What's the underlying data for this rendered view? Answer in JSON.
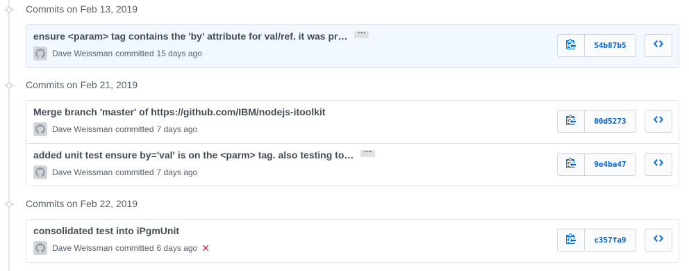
{
  "groups": [
    {
      "title": "Commits on Feb 13, 2019",
      "commits": [
        {
          "message": "ensure <param> tag contains the 'by' attribute for val/ref. it was pr…",
          "has_more": true,
          "author": "Dave Weissman",
          "committed_label": "committed",
          "time": "15 days ago",
          "sha": "54b87b5",
          "status": "",
          "highlighted": true
        }
      ]
    },
    {
      "title": "Commits on Feb 21, 2019",
      "commits": [
        {
          "message": "Merge branch 'master' of https://github.com/IBM/nodejs-itoolkit",
          "has_more": false,
          "author": "Dave Weissman",
          "committed_label": "committed",
          "time": "7 days ago",
          "sha": "00d5273",
          "status": ""
        },
        {
          "message": "added unit test ensure by='val' is on the <parm> tag. also testing to…",
          "has_more": true,
          "author": "Dave Weissman",
          "committed_label": "committed",
          "time": "7 days ago",
          "sha": "9e4ba47",
          "status": ""
        }
      ]
    },
    {
      "title": "Commits on Feb 22, 2019",
      "commits": [
        {
          "message": "consolidated test into iPgmUnit",
          "has_more": false,
          "author": "Dave Weissman",
          "committed_label": "committed",
          "time": "6 days ago",
          "sha": "c357fa9",
          "status": "failed"
        }
      ]
    }
  ],
  "icons": {
    "timeline_dot": "git-commit-icon",
    "avatar": "avatar-icon",
    "copy": "clipboard-icon",
    "browse": "code-icon",
    "failed": "x-icon"
  },
  "colors": {
    "sha": "#0366d6",
    "failed": "#cb2431",
    "highlight": "#f1f8ff"
  }
}
